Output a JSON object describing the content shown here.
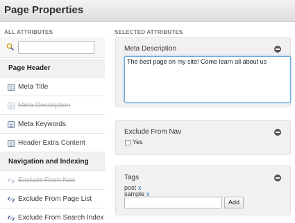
{
  "header": {
    "title": "Page Properties"
  },
  "left": {
    "heading": "ALL ATTRIBUTES",
    "search": {
      "value": "",
      "placeholder": ""
    },
    "groups": [
      {
        "title": "Page Header",
        "items": [
          {
            "label": "Meta Title",
            "disabled": false,
            "icon": "document-icon"
          },
          {
            "label": "Meta Description",
            "disabled": true,
            "icon": "document-icon"
          },
          {
            "label": "Meta Keywords",
            "disabled": false,
            "icon": "document-icon"
          },
          {
            "label": "Header Extra Content",
            "disabled": false,
            "icon": "document-icon"
          }
        ]
      },
      {
        "title": "Navigation and Indexing",
        "items": [
          {
            "label": "Exclude From Nav",
            "disabled": true,
            "icon": "link-icon"
          },
          {
            "label": "Exclude From Page List",
            "disabled": false,
            "icon": "link-icon"
          },
          {
            "label": "Exclude From Search Index",
            "disabled": false,
            "icon": "link-icon"
          }
        ]
      }
    ]
  },
  "right": {
    "heading": "SELECTED ATTRIBUTES",
    "meta_description": {
      "title": "Meta Description",
      "value": "The best page on my site! Come learn all about us"
    },
    "exclude_from_nav": {
      "title": "Exclude From Nav",
      "checkbox_label": "Yes",
      "checked": false
    },
    "tags": {
      "title": "Tags",
      "items": [
        {
          "name": "post",
          "remove": "x"
        },
        {
          "name": "sample",
          "remove": "x"
        }
      ],
      "input_value": "",
      "add_label": "Add"
    }
  },
  "colors": {
    "accent": "#1e7bc4",
    "focus": "#6aa8dc"
  }
}
